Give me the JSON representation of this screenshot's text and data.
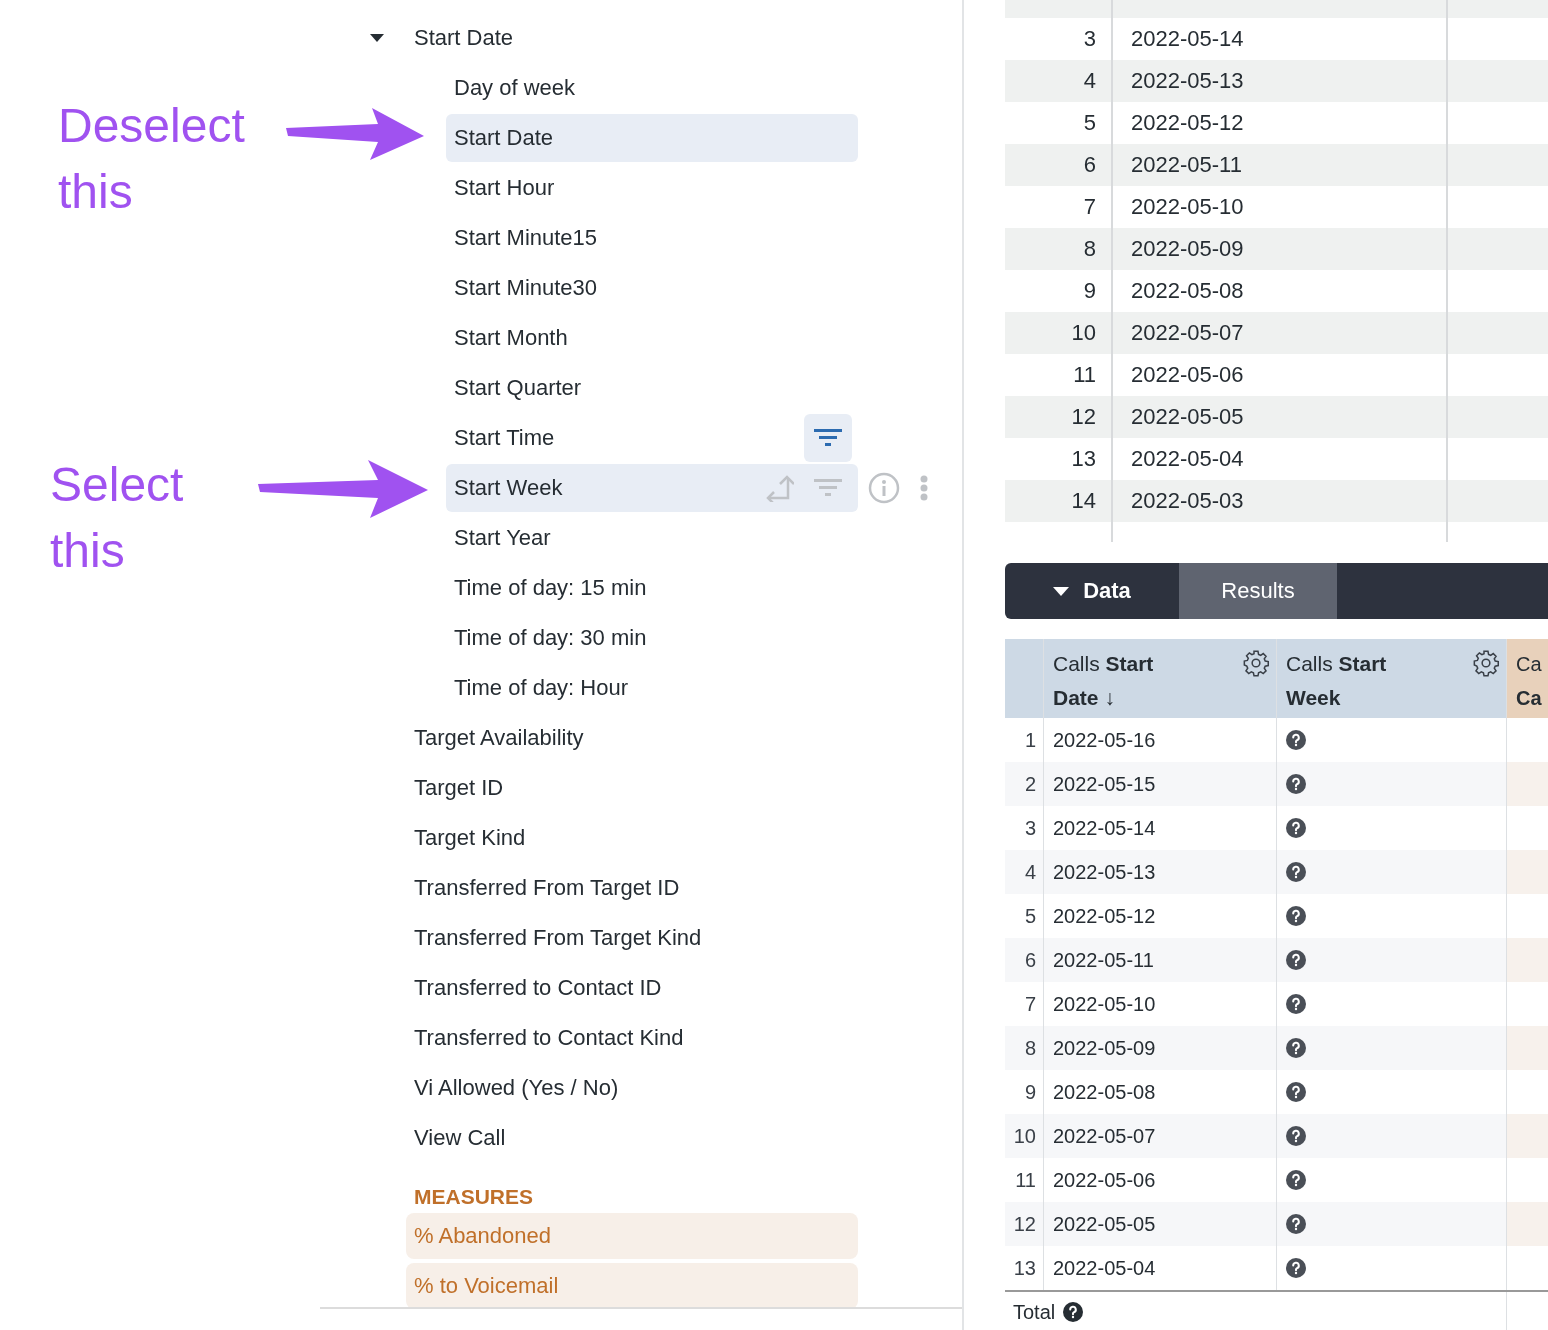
{
  "annotations": [
    {
      "text": "Deselect this"
    },
    {
      "text": "Select this"
    }
  ],
  "field_picker": {
    "group": {
      "label": "Start Date",
      "expanded": true,
      "children": [
        {
          "label": "Day of week",
          "selected": false,
          "hovered": false,
          "filtered": false
        },
        {
          "label": "Start Date",
          "selected": true,
          "hovered": false,
          "filtered": false
        },
        {
          "label": "Start Hour",
          "selected": false,
          "hovered": false,
          "filtered": false
        },
        {
          "label": "Start Minute15",
          "selected": false,
          "hovered": false,
          "filtered": false
        },
        {
          "label": "Start Minute30",
          "selected": false,
          "hovered": false,
          "filtered": false
        },
        {
          "label": "Start Month",
          "selected": false,
          "hovered": false,
          "filtered": false
        },
        {
          "label": "Start Quarter",
          "selected": false,
          "hovered": false,
          "filtered": false
        },
        {
          "label": "Start Time",
          "selected": false,
          "hovered": false,
          "filtered": true
        },
        {
          "label": "Start Week",
          "selected": false,
          "hovered": true,
          "filtered": false
        },
        {
          "label": "Start Year",
          "selected": false,
          "hovered": false,
          "filtered": false
        },
        {
          "label": "Time of day: 15 min",
          "selected": false,
          "hovered": false,
          "filtered": false
        },
        {
          "label": "Time of day: 30 min",
          "selected": false,
          "hovered": false,
          "filtered": false
        },
        {
          "label": "Time of day: Hour",
          "selected": false,
          "hovered": false,
          "filtered": false
        }
      ]
    },
    "fields": [
      "Target Availability",
      "Target ID",
      "Target Kind",
      "Transferred From Target ID",
      "Transferred From Target Kind",
      "Transferred to Contact ID",
      "Transferred to Contact Kind",
      "Vi Allowed (Yes / No)",
      "View Call"
    ],
    "measures_heading": "MEASURES",
    "measures": [
      "% Abandoned",
      "% to Voicemail"
    ]
  },
  "results_preview": {
    "rows": [
      {
        "n": "3",
        "date": "2022-05-14"
      },
      {
        "n": "4",
        "date": "2022-05-13"
      },
      {
        "n": "5",
        "date": "2022-05-12"
      },
      {
        "n": "6",
        "date": "2022-05-11"
      },
      {
        "n": "7",
        "date": "2022-05-10"
      },
      {
        "n": "8",
        "date": "2022-05-09"
      },
      {
        "n": "9",
        "date": "2022-05-08"
      },
      {
        "n": "10",
        "date": "2022-05-07"
      },
      {
        "n": "11",
        "date": "2022-05-06"
      },
      {
        "n": "12",
        "date": "2022-05-05"
      },
      {
        "n": "13",
        "date": "2022-05-04"
      },
      {
        "n": "14",
        "date": "2022-05-03"
      }
    ]
  },
  "tabs": [
    {
      "label": "Data",
      "selected": true
    },
    {
      "label": "Results",
      "selected": false
    }
  ],
  "data_table": {
    "columns": [
      {
        "label": "Calls **Start Date**",
        "sort": "↓",
        "kind": "dimension"
      },
      {
        "label": "Calls **Start Week**",
        "kind": "dimension"
      },
      {
        "label": "Ca **Ca**",
        "kind": "measure"
      }
    ],
    "rows": [
      {
        "n": "1",
        "date": "2022-05-16"
      },
      {
        "n": "2",
        "date": "2022-05-15"
      },
      {
        "n": "3",
        "date": "2022-05-14"
      },
      {
        "n": "4",
        "date": "2022-05-13"
      },
      {
        "n": "5",
        "date": "2022-05-12"
      },
      {
        "n": "6",
        "date": "2022-05-11"
      },
      {
        "n": "7",
        "date": "2022-05-10"
      },
      {
        "n": "8",
        "date": "2022-05-09"
      },
      {
        "n": "9",
        "date": "2022-05-08"
      },
      {
        "n": "10",
        "date": "2022-05-07"
      },
      {
        "n": "11",
        "date": "2022-05-06"
      },
      {
        "n": "12",
        "date": "2022-05-05"
      },
      {
        "n": "13",
        "date": "2022-05-04"
      }
    ],
    "total_label": "Total"
  }
}
